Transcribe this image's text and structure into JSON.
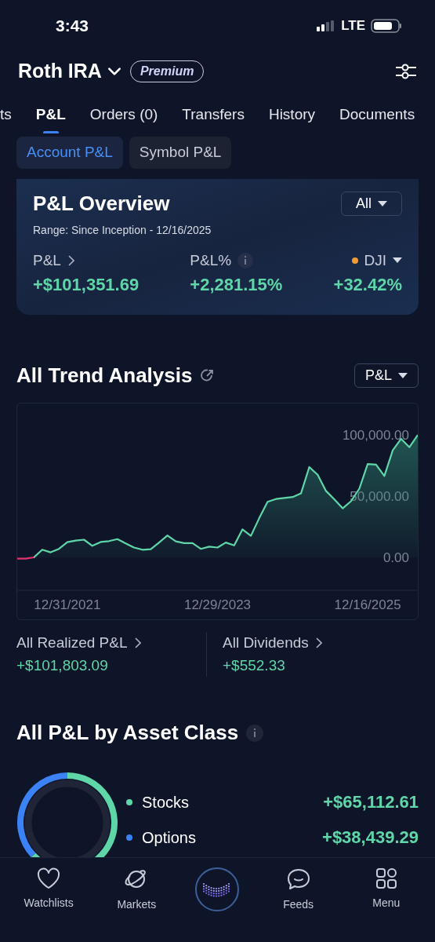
{
  "status_bar": {
    "time": "3:43",
    "network": "LTE"
  },
  "header": {
    "account": "Roth IRA",
    "badge": "Premium"
  },
  "tabs": [
    {
      "label": "ts",
      "selected": false
    },
    {
      "label": "P&L",
      "selected": true
    },
    {
      "label": "Orders (0)",
      "selected": false
    },
    {
      "label": "Transfers",
      "selected": false
    },
    {
      "label": "History",
      "selected": false
    },
    {
      "label": "Documents",
      "selected": false
    }
  ],
  "segments": [
    {
      "label": "Account P&L",
      "selected": true
    },
    {
      "label": "Symbol P&L",
      "selected": false
    }
  ],
  "overview": {
    "title": "P&L Overview",
    "range": "Range: Since Inception - 12/16/2025",
    "filter": "All",
    "metrics": [
      {
        "kind": "link",
        "label": "P&L",
        "value": "+$101,351.69"
      },
      {
        "kind": "info",
        "label": "P&L%",
        "value": "+2,281.15%"
      },
      {
        "kind": "index",
        "label": "DJI",
        "value": "+32.42%"
      }
    ]
  },
  "trend": {
    "title": "All Trend Analysis",
    "selector": "P&L",
    "chart_data": {
      "type": "area",
      "categories": [
        null,
        null,
        null,
        null,
        null,
        null,
        "12/31/2021",
        null,
        null,
        null,
        null,
        null,
        null,
        null,
        null,
        null,
        null,
        null,
        null,
        null,
        null,
        null,
        null,
        null,
        "12/29/2023",
        null,
        null,
        null,
        null,
        null,
        null,
        null,
        null,
        null,
        null,
        null,
        null,
        null,
        null,
        null,
        null,
        null,
        "12/16/2025",
        null,
        null,
        null,
        null,
        null,
        null
      ],
      "ylim": [
        -26900,
        125600
      ],
      "yticks": [
        {
          "value": 0,
          "label": "0.00"
        },
        {
          "value": 50000,
          "label": "50,000.00"
        },
        {
          "value": 100000,
          "label": "100,000.00"
        }
      ],
      "series": [
        {
          "color": "#5fd6a8",
          "values": [
            -1100,
            -1100,
            0,
            6200,
            4100,
            6900,
            12400,
            13700,
            14400,
            9400,
            12600,
            13300,
            14900,
            11400,
            8000,
            6200,
            6600,
            12100,
            17800,
            13000,
            11700,
            11700,
            6900,
            8700,
            8000,
            12100,
            9800,
            22900,
            17600,
            32000,
            45300,
            47600,
            48500,
            49200,
            52200,
            73700,
            67500,
            54200,
            47400,
            40000,
            45800,
            56100,
            76200,
            75700,
            66400,
            87400,
            96800,
            89900,
            100000
          ]
        }
      ]
    },
    "stats": [
      {
        "label": "All Realized P&L",
        "value": "+$101,803.09"
      },
      {
        "label": "All Dividends",
        "value": "+$552.33"
      }
    ]
  },
  "asset_class": {
    "title": "All P&L by Asset Class",
    "items": [
      {
        "label": "Stocks",
        "value": "+$65,112.61",
        "color": "#5fd6a8"
      },
      {
        "label": "Options",
        "value": "+$38,439.29",
        "color": "#3b82f6"
      }
    ]
  },
  "nav": [
    {
      "kind": "heart",
      "label": "Watchlists"
    },
    {
      "kind": "planet",
      "label": "Markets"
    },
    {
      "kind": "assistant"
    },
    {
      "kind": "chat",
      "label": "Feeds"
    },
    {
      "kind": "grid",
      "label": "Menu"
    }
  ]
}
